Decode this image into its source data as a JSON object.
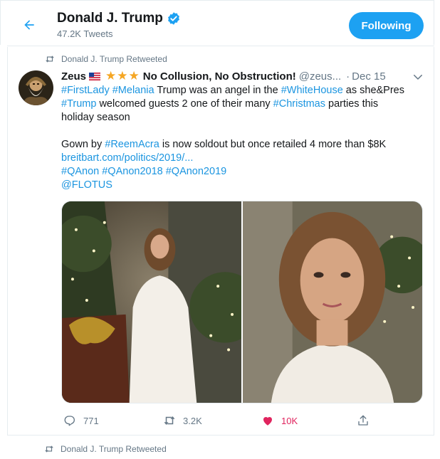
{
  "header": {
    "profile_name": "Donald J. Trump",
    "tweet_count": "47.2K Tweets",
    "follow_label": "Following"
  },
  "tweet": {
    "retweeted_by": "Donald J. Trump Retweeted",
    "author": "Zeus",
    "author_rest": "No Collusion, No Obstruction!",
    "handle": "@zeus...",
    "date": "Dec 15",
    "text": {
      "l1_tag1": "#FirstLady",
      "l1_tag2": "#Melania",
      "l1_mid": " Trump was an angel in the ",
      "l1_tag3": "#WhiteHouse",
      "l1_end": " as she&Pres",
      "l2_tag1": "#Trump",
      "l2_mid": " welcomed guests 2 one of their many ",
      "l2_tag2": "#Christmas",
      "l2_end": " parties this",
      "l3": "holiday season",
      "l4_start": "Gown by ",
      "l4_tag": "#ReemAcra",
      "l4_end": " is now soldout but once retailed 4 more than $8K",
      "link": "breitbart.com/politics/2019/...",
      "tags_line": "#QAnon #QAnon2018 #QAnon2019",
      "mention": "@FLOTUS"
    },
    "actions": {
      "replies": "771",
      "retweets": "3.2K",
      "likes": "10K"
    }
  },
  "next_tweet": {
    "retweeted_by": "Donald J. Trump Retweeted"
  },
  "colors": {
    "accent": "#1da1f2",
    "link": "#1b95e0",
    "like": "#e0245e",
    "muted": "#657786"
  }
}
